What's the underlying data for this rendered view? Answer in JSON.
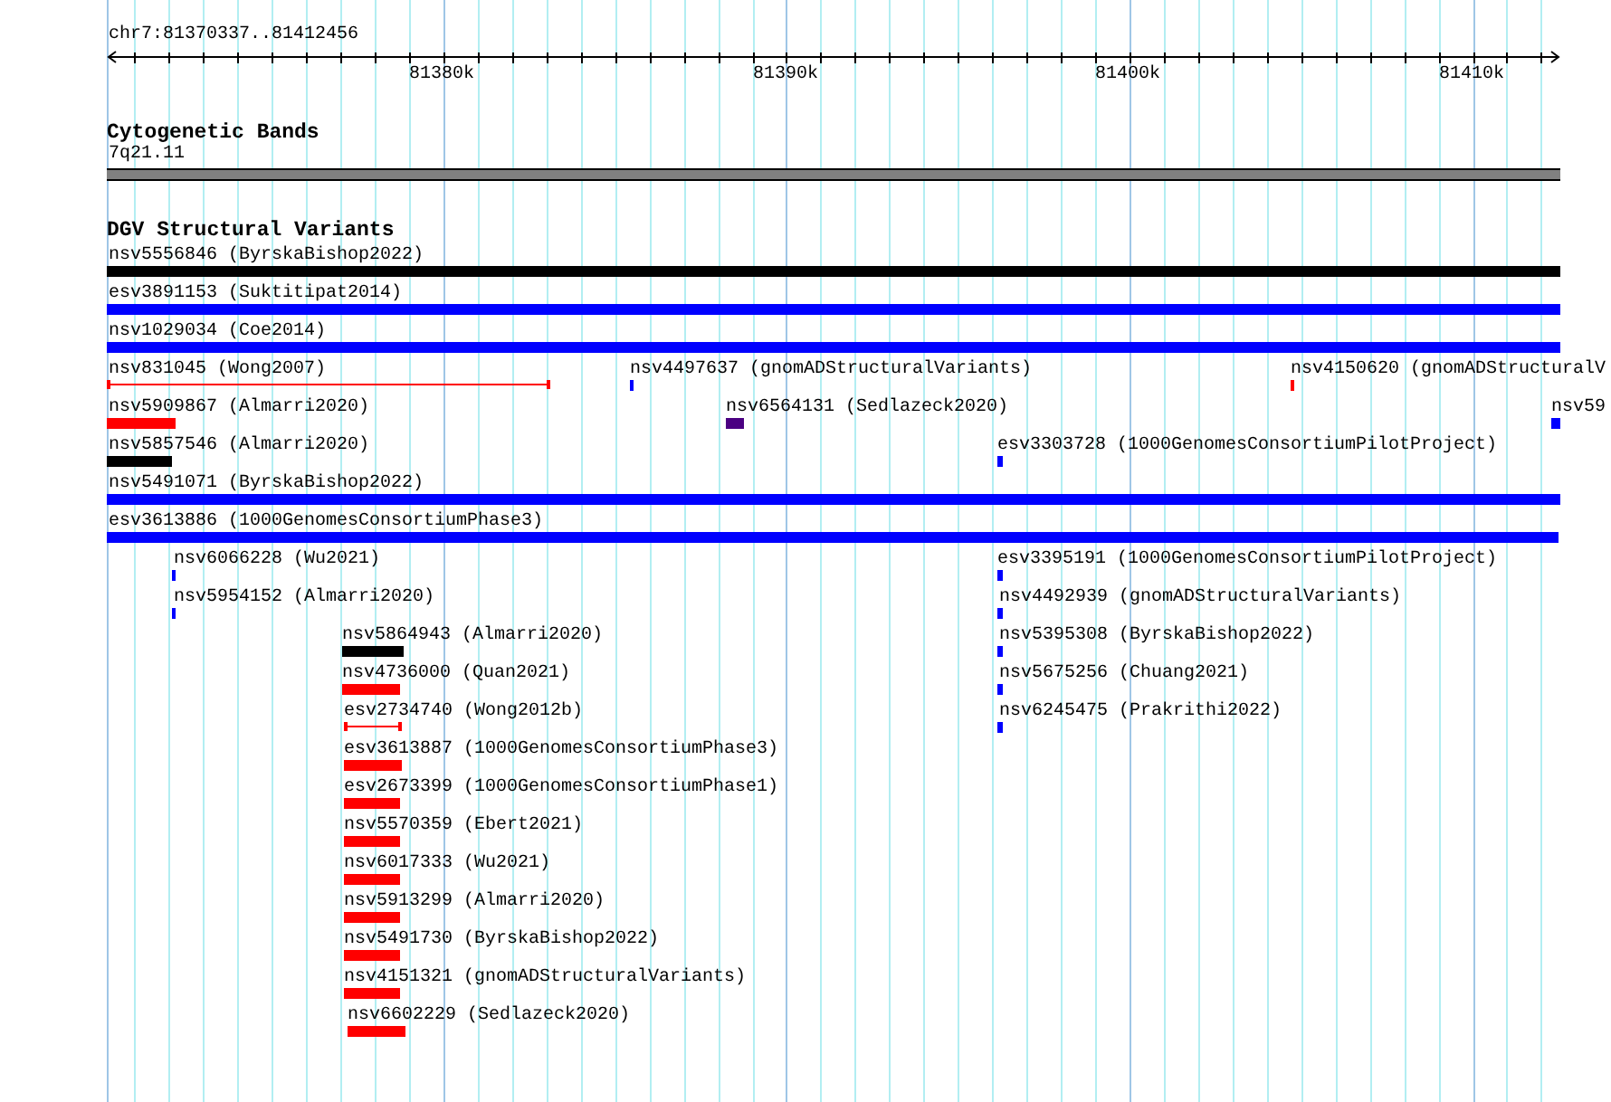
{
  "ruler": {
    "location": "chr7:81370337..81412456",
    "tick_labels": [
      "81380k",
      "81390k",
      "81400k",
      "81410k"
    ]
  },
  "cytoband_track": {
    "title": "Cytogenetic Bands",
    "band": "7q21.11"
  },
  "variant_track": {
    "title": "DGV Structural Variants",
    "features": [
      {
        "label": "nsv5556846 (ByrskaBishop2022)",
        "kind": "bar",
        "color": "#000000"
      },
      {
        "label": "esv3891153 (Suktitipat2014)",
        "kind": "bar",
        "color": "#0000ff"
      },
      {
        "label": "nsv1029034 (Coe2014)",
        "kind": "bar",
        "color": "#0000ff"
      },
      {
        "label": "nsv831045 (Wong2007)",
        "kind": "line",
        "color": "#ff0000"
      },
      {
        "label": "nsv4497637 (gnomADStructuralVariants)",
        "kind": "bar",
        "color": "#0000ff"
      },
      {
        "label": "nsv4150620 (gnomADStructuralV",
        "kind": "bar",
        "color": "#ff0000"
      },
      {
        "label": "nsv5909867 (Almarri2020)",
        "kind": "bar",
        "color": "#ff0000"
      },
      {
        "label": "nsv6564131 (Sedlazeck2020)",
        "kind": "bar",
        "color": "#4b0082"
      },
      {
        "label": "nsv59",
        "kind": "bar",
        "color": "#0000ff"
      },
      {
        "label": "nsv5857546 (Almarri2020)",
        "kind": "bar",
        "color": "#000000"
      },
      {
        "label": "esv3303728 (1000GenomesConsortiumPilotProject)",
        "kind": "bar",
        "color": "#0000ff"
      },
      {
        "label": "nsv5491071 (ByrskaBishop2022)",
        "kind": "bar",
        "color": "#0000ff"
      },
      {
        "label": "esv3613886 (1000GenomesConsortiumPhase3)",
        "kind": "bar",
        "color": "#0000ff"
      },
      {
        "label": "nsv6066228 (Wu2021)",
        "kind": "bar",
        "color": "#0000ff"
      },
      {
        "label": "esv3395191 (1000GenomesConsortiumPilotProject)",
        "kind": "bar",
        "color": "#0000ff"
      },
      {
        "label": "nsv5954152 (Almarri2020)",
        "kind": "bar",
        "color": "#0000ff"
      },
      {
        "label": "nsv4492939 (gnomADStructuralVariants)",
        "kind": "bar",
        "color": "#0000ff"
      },
      {
        "label": "nsv5864943 (Almarri2020)",
        "kind": "bar",
        "color": "#000000"
      },
      {
        "label": "nsv5395308 (ByrskaBishop2022)",
        "kind": "bar",
        "color": "#0000ff"
      },
      {
        "label": "nsv4736000 (Quan2021)",
        "kind": "bar",
        "color": "#ff0000"
      },
      {
        "label": "nsv5675256 (Chuang2021)",
        "kind": "bar",
        "color": "#0000ff"
      },
      {
        "label": "esv2734740 (Wong2012b)",
        "kind": "line",
        "color": "#ff0000"
      },
      {
        "label": "nsv6245475 (Prakrithi2022)",
        "kind": "bar",
        "color": "#0000ff"
      },
      {
        "label": "esv3613887 (1000GenomesConsortiumPhase3)",
        "kind": "bar",
        "color": "#ff0000"
      },
      {
        "label": "esv2673399 (1000GenomesConsortiumPhase1)",
        "kind": "bar",
        "color": "#ff0000"
      },
      {
        "label": "nsv5570359 (Ebert2021)",
        "kind": "bar",
        "color": "#ff0000"
      },
      {
        "label": "nsv6017333 (Wu2021)",
        "kind": "bar",
        "color": "#ff0000"
      },
      {
        "label": "nsv5913299 (Almarri2020)",
        "kind": "bar",
        "color": "#ff0000"
      },
      {
        "label": "nsv5491730 (ByrskaBishop2022)",
        "kind": "bar",
        "color": "#ff0000"
      },
      {
        "label": "nsv4151321 (gnomADStructuralVariants)",
        "kind": "bar",
        "color": "#ff0000"
      },
      {
        "label": "nsv6602229 (Sedlazeck2020)",
        "kind": "bar",
        "color": "#ff0000"
      }
    ]
  }
}
